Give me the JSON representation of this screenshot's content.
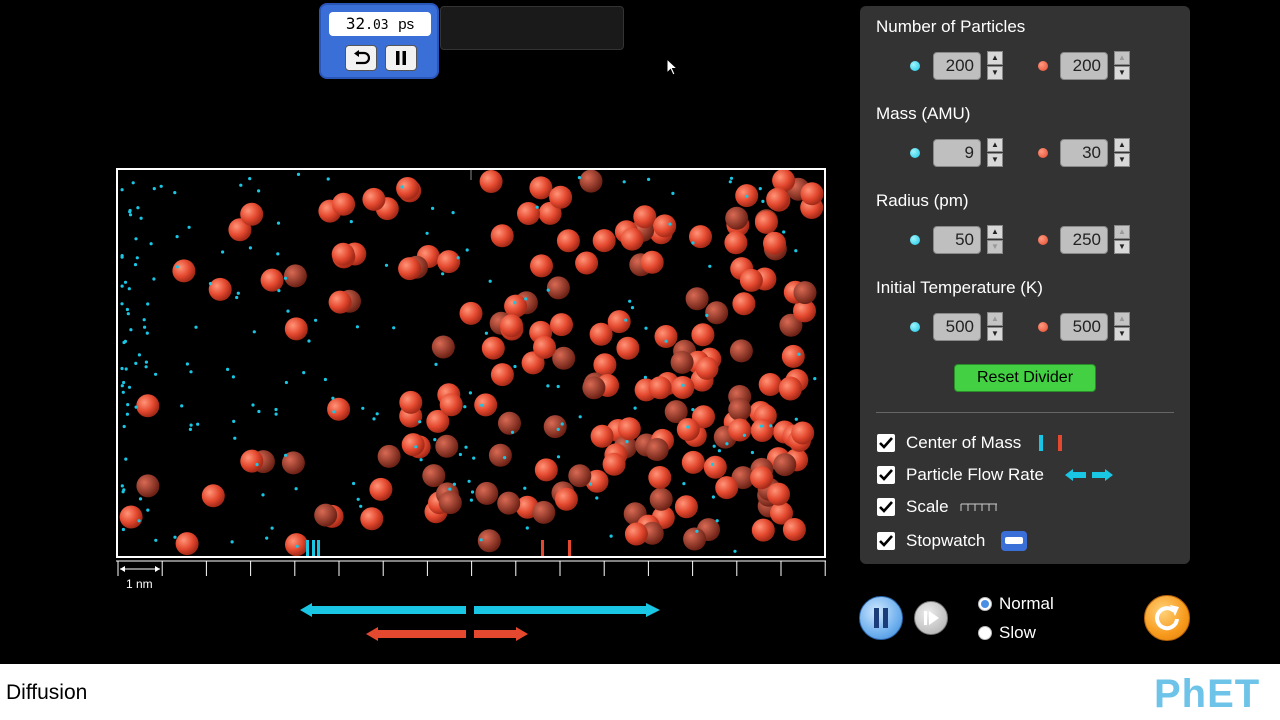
{
  "stopwatch": {
    "time_main": "32",
    "time_fraction": ".03",
    "unit": "ps"
  },
  "particles": {
    "seed": 7
  },
  "controls": {
    "number_of_particles": {
      "title": "Number of Particles",
      "left": "200",
      "right": "200"
    },
    "mass": {
      "title": "Mass (AMU)",
      "left": "9",
      "right": "30"
    },
    "radius": {
      "title": "Radius (pm)",
      "left": "50",
      "right": "250"
    },
    "temperature": {
      "title": "Initial Temperature (K)",
      "left": "500",
      "right": "500"
    },
    "reset_divider": "Reset Divider",
    "checkboxes": {
      "center_of_mass": "Center of Mass",
      "particle_flow_rate": "Particle Flow Rate",
      "scale": "Scale",
      "stopwatch": "Stopwatch"
    }
  },
  "scale": {
    "label": "1 nm"
  },
  "play": {
    "speed_normal": "Normal",
    "speed_slow": "Slow",
    "selected_speed": "Normal"
  },
  "footer": {
    "title": "Diffusion",
    "logo": "PhET"
  },
  "colors": {
    "blue_particle": "#19c7e5",
    "red_particle": "#e4492f",
    "panel": "#333333",
    "reset_green": "#43d043",
    "play_blue": "#6fb0ee",
    "reset_orange": "#f79a1c"
  }
}
